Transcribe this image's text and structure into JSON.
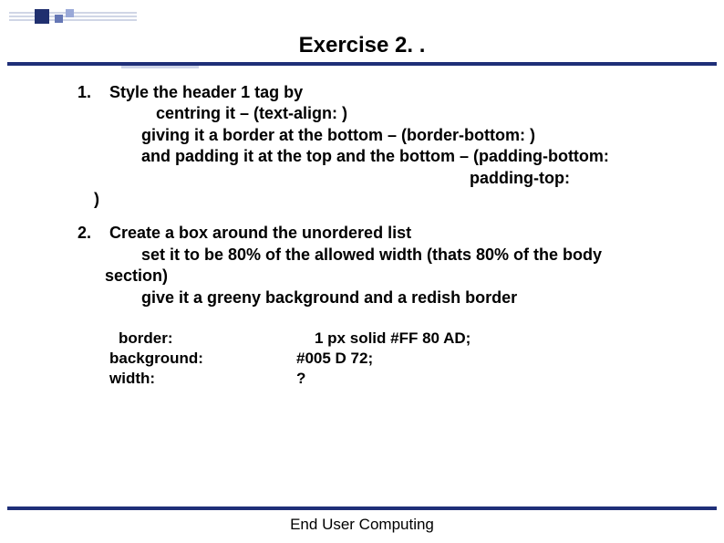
{
  "title": "Exercise 2. .",
  "item1": {
    "num": "1.",
    "lead": "Style the header 1 tag by",
    "line_a": "centring it – (text-align:      )",
    "line_b": "giving it a border at the bottom – (border-bottom:      )",
    "line_c": "and padding it at the top and the bottom – (padding-bottom:",
    "line_d": "padding-top:",
    "close": ")"
  },
  "item2": {
    "num": "2.",
    "lead": "Create a box around the unordered list",
    "line_a": "set it to be 80% of the allowed width (thats 80% of the body",
    "cont_a": "section)",
    "line_b": "give it a greeny background and a redish border"
  },
  "css": {
    "r1p": "border:",
    "r1v": "1 px solid #FF 80 AD;",
    "r2p": "background:",
    "r2v": "#005 D 72;",
    "r3p": "width:",
    "r3v": "?"
  },
  "footer": "End User Computing"
}
